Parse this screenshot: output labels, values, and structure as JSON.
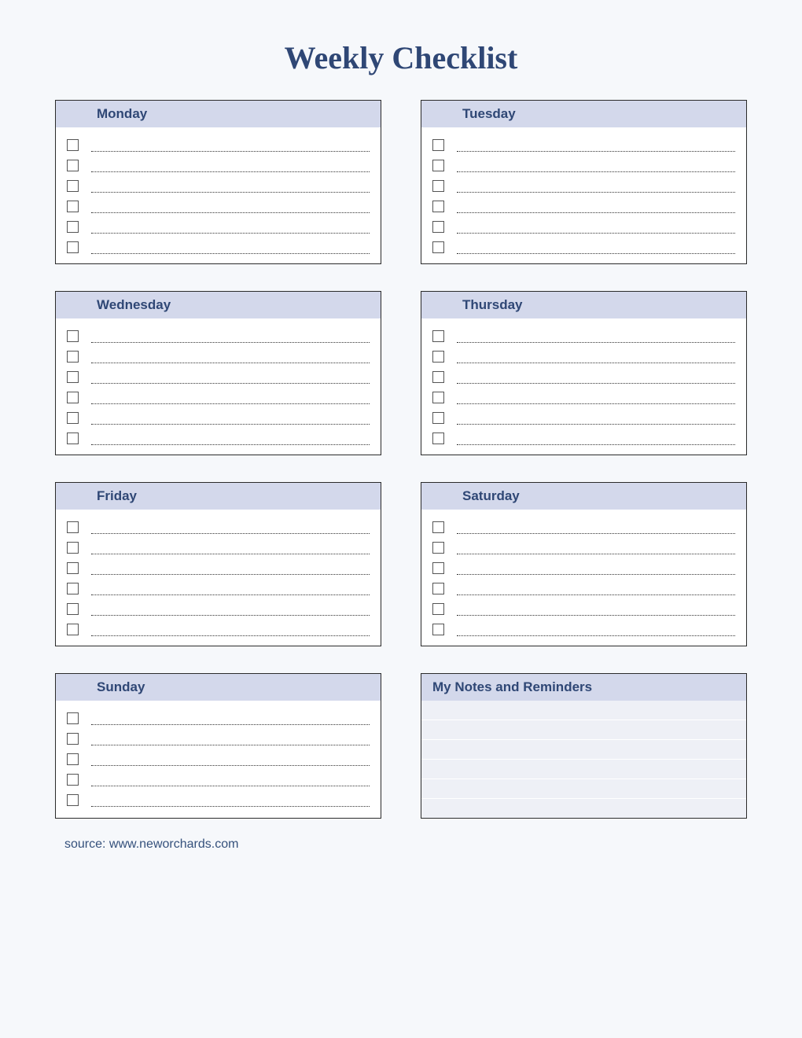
{
  "title": "Weekly Checklist",
  "days": [
    "Monday",
    "Tuesday",
    "Wednesday",
    "Thursday",
    "Friday",
    "Saturday",
    "Sunday"
  ],
  "notes_header": "My Notes and Reminders",
  "source": "source: www.neworchards.com"
}
